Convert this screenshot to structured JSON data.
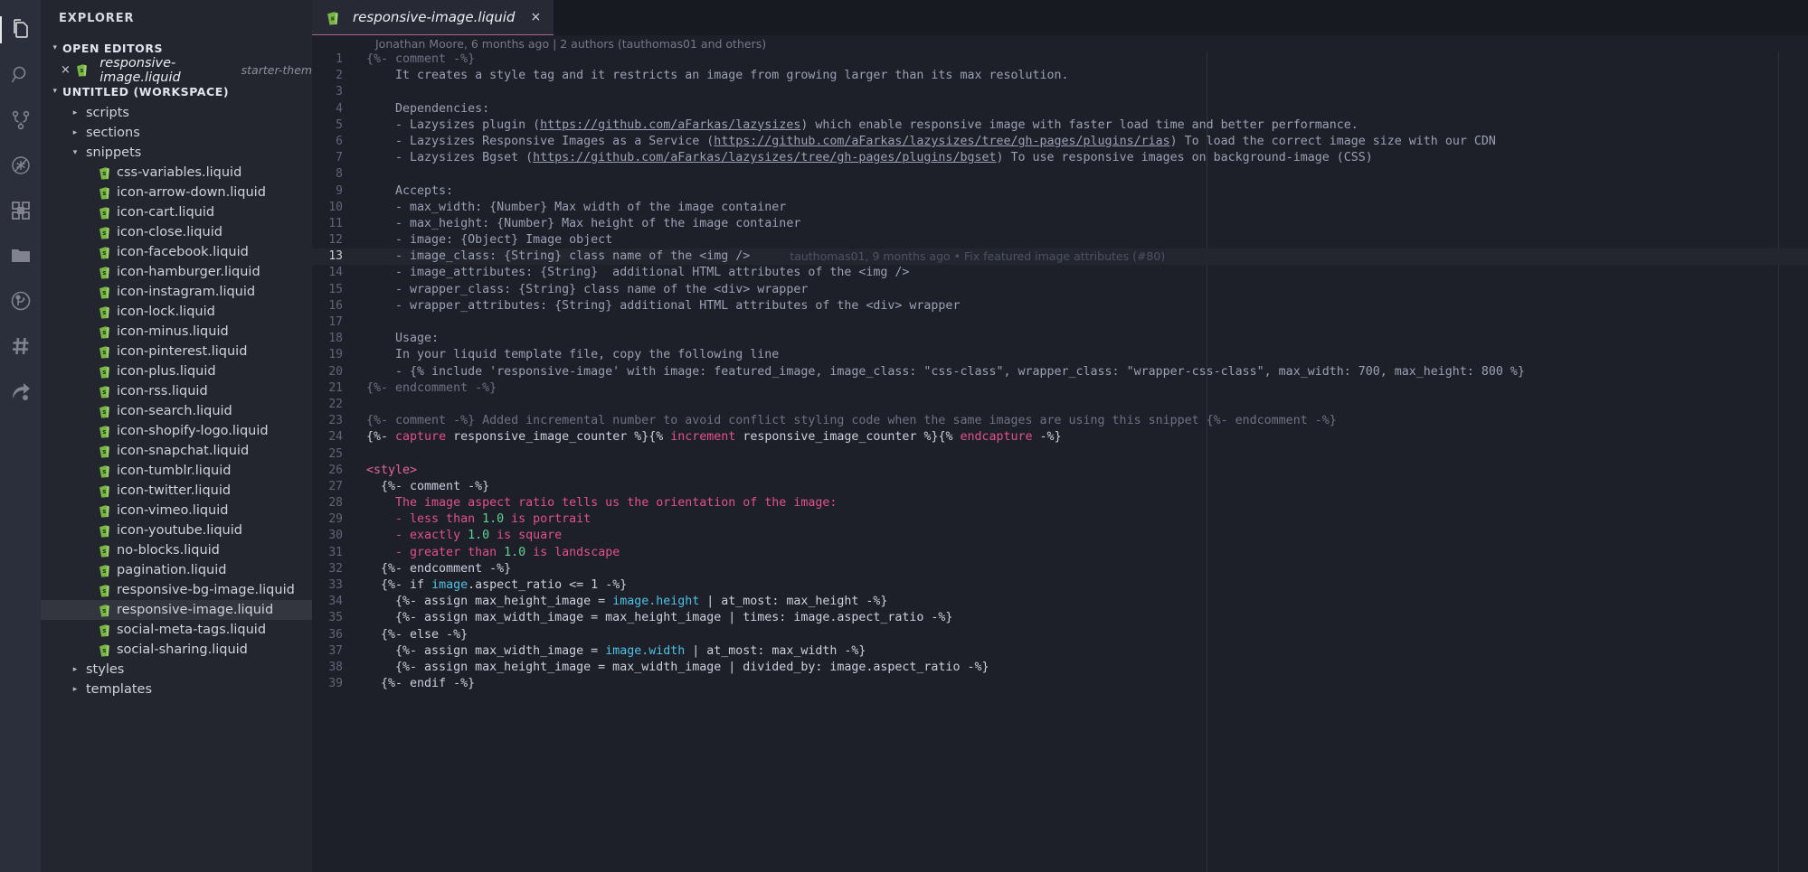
{
  "activity_bar": {
    "items": [
      {
        "name": "explorer",
        "icon": "files-icon",
        "active": true
      },
      {
        "name": "search",
        "icon": "search-icon",
        "active": false
      },
      {
        "name": "source-control",
        "icon": "source-control-icon",
        "active": false
      },
      {
        "name": "run-and-debug",
        "icon": "debug-disabled-icon",
        "active": false
      },
      {
        "name": "extensions",
        "icon": "extensions-icon",
        "active": false
      },
      {
        "name": "project-manager",
        "icon": "folder-icon",
        "active": false
      },
      {
        "name": "gitlens",
        "icon": "gitlens-icon",
        "active": false
      },
      {
        "name": "settings-sync",
        "icon": "hash-icon",
        "active": false
      },
      {
        "name": "share",
        "icon": "share-icon",
        "active": false
      }
    ]
  },
  "sidebar": {
    "title": "EXPLORER",
    "open_editors": {
      "label": "OPEN EDITORS",
      "expanded": true,
      "items": [
        {
          "close": "×",
          "name": "responsive-image.liquid",
          "description": "starter-them...",
          "icon": "liquid-icon"
        }
      ]
    },
    "workspace": {
      "label": "UNTITLED (WORKSPACE)",
      "expanded": true,
      "tree": [
        {
          "label": "scripts",
          "type": "folder",
          "expanded": false,
          "depth": 1
        },
        {
          "label": "sections",
          "type": "folder",
          "expanded": false,
          "depth": 1
        },
        {
          "label": "snippets",
          "type": "folder",
          "expanded": true,
          "depth": 1
        },
        {
          "label": "css-variables.liquid",
          "type": "file",
          "depth": 2
        },
        {
          "label": "icon-arrow-down.liquid",
          "type": "file",
          "depth": 2
        },
        {
          "label": "icon-cart.liquid",
          "type": "file",
          "depth": 2
        },
        {
          "label": "icon-close.liquid",
          "type": "file",
          "depth": 2
        },
        {
          "label": "icon-facebook.liquid",
          "type": "file",
          "depth": 2
        },
        {
          "label": "icon-hamburger.liquid",
          "type": "file",
          "depth": 2
        },
        {
          "label": "icon-instagram.liquid",
          "type": "file",
          "depth": 2
        },
        {
          "label": "icon-lock.liquid",
          "type": "file",
          "depth": 2
        },
        {
          "label": "icon-minus.liquid",
          "type": "file",
          "depth": 2
        },
        {
          "label": "icon-pinterest.liquid",
          "type": "file",
          "depth": 2
        },
        {
          "label": "icon-plus.liquid",
          "type": "file",
          "depth": 2
        },
        {
          "label": "icon-rss.liquid",
          "type": "file",
          "depth": 2
        },
        {
          "label": "icon-search.liquid",
          "type": "file",
          "depth": 2
        },
        {
          "label": "icon-shopify-logo.liquid",
          "type": "file",
          "depth": 2
        },
        {
          "label": "icon-snapchat.liquid",
          "type": "file",
          "depth": 2
        },
        {
          "label": "icon-tumblr.liquid",
          "type": "file",
          "depth": 2
        },
        {
          "label": "icon-twitter.liquid",
          "type": "file",
          "depth": 2
        },
        {
          "label": "icon-vimeo.liquid",
          "type": "file",
          "depth": 2
        },
        {
          "label": "icon-youtube.liquid",
          "type": "file",
          "depth": 2
        },
        {
          "label": "no-blocks.liquid",
          "type": "file",
          "depth": 2
        },
        {
          "label": "pagination.liquid",
          "type": "file",
          "depth": 2
        },
        {
          "label": "responsive-bg-image.liquid",
          "type": "file",
          "depth": 2
        },
        {
          "label": "responsive-image.liquid",
          "type": "file",
          "depth": 2,
          "selected": true
        },
        {
          "label": "social-meta-tags.liquid",
          "type": "file",
          "depth": 2
        },
        {
          "label": "social-sharing.liquid",
          "type": "file",
          "depth": 2
        },
        {
          "label": "styles",
          "type": "folder",
          "expanded": false,
          "depth": 1
        },
        {
          "label": "templates",
          "type": "folder",
          "expanded": false,
          "depth": 1
        }
      ]
    }
  },
  "editor": {
    "tab": {
      "title": "responsive-image.liquid",
      "icon": "liquid-icon",
      "close": "×",
      "active": true
    },
    "blame_header": "Jonathan Moore, 6 months ago | 2 authors (tauthomas01 and others)",
    "cursor_line": 13,
    "inline_blame": "tauthomas01, 9 months ago • Fix featured image attributes (#80)",
    "lines": [
      {
        "n": 1,
        "mod": false,
        "segs": [
          {
            "t": "{%- comment -%}",
            "c": "c-comment"
          }
        ]
      },
      {
        "n": 2,
        "mod": true,
        "segs": [
          {
            "t": "    It creates a style tag and it restricts an image from growing larger than its max resolution.",
            "c": "c-doc"
          }
        ]
      },
      {
        "n": 3,
        "mod": true,
        "segs": [
          {
            "t": "",
            "c": "c-doc"
          }
        ]
      },
      {
        "n": 4,
        "mod": true,
        "segs": [
          {
            "t": "    Dependencies:",
            "c": "c-doc"
          }
        ]
      },
      {
        "n": 5,
        "mod": true,
        "segs": [
          {
            "t": "    - Lazysizes plugin (",
            "c": "c-doc"
          },
          {
            "t": "https://github.com/aFarkas/lazysizes",
            "c": "c-link"
          },
          {
            "t": ") which enable responsive image with faster load time and better performance.",
            "c": "c-doc"
          }
        ]
      },
      {
        "n": 6,
        "mod": true,
        "segs": [
          {
            "t": "    - Lazysizes Responsive Images as a Service (",
            "c": "c-doc"
          },
          {
            "t": "https://github.com/aFarkas/lazysizes/tree/gh-pages/plugins/rias",
            "c": "c-link"
          },
          {
            "t": ") To load the correct image size with our CDN",
            "c": "c-doc"
          }
        ]
      },
      {
        "n": 7,
        "mod": true,
        "segs": [
          {
            "t": "    - Lazysizes Bgset (",
            "c": "c-doc"
          },
          {
            "t": "https://github.com/aFarkas/lazysizes/tree/gh-pages/plugins/bgset",
            "c": "c-link"
          },
          {
            "t": ") To use responsive images on background-image (CSS)",
            "c": "c-doc"
          }
        ]
      },
      {
        "n": 8,
        "mod": true,
        "segs": [
          {
            "t": "",
            "c": "c-doc"
          }
        ]
      },
      {
        "n": 9,
        "mod": true,
        "segs": [
          {
            "t": "    Accepts:",
            "c": "c-doc"
          }
        ]
      },
      {
        "n": 10,
        "mod": true,
        "segs": [
          {
            "t": "    - max_width: {Number} Max width of the image container",
            "c": "c-doc"
          }
        ]
      },
      {
        "n": 11,
        "mod": true,
        "segs": [
          {
            "t": "    - max_height: {Number} Max height of the image container",
            "c": "c-doc"
          }
        ]
      },
      {
        "n": 12,
        "mod": true,
        "segs": [
          {
            "t": "    - image: {Object} Image object",
            "c": "c-doc"
          }
        ]
      },
      {
        "n": 13,
        "mod": true,
        "cursor": true,
        "segs": [
          {
            "t": "    - image_class: {String} class name of the <img />",
            "c": "c-doc"
          }
        ]
      },
      {
        "n": 14,
        "mod": true,
        "segs": [
          {
            "t": "    - image_attributes: {String}  additional HTML attributes of the <img />",
            "c": "c-doc"
          }
        ]
      },
      {
        "n": 15,
        "mod": true,
        "segs": [
          {
            "t": "    - wrapper_class: {String} class name of the <div> wrapper",
            "c": "c-doc"
          }
        ]
      },
      {
        "n": 16,
        "mod": true,
        "segs": [
          {
            "t": "    - wrapper_attributes: {String} additional HTML attributes of the <div> wrapper",
            "c": "c-doc"
          }
        ]
      },
      {
        "n": 17,
        "mod": true,
        "segs": [
          {
            "t": "",
            "c": "c-doc"
          }
        ]
      },
      {
        "n": 18,
        "mod": true,
        "segs": [
          {
            "t": "    Usage:",
            "c": "c-doc"
          }
        ]
      },
      {
        "n": 19,
        "mod": true,
        "segs": [
          {
            "t": "    In your liquid template file, copy the following line",
            "c": "c-doc"
          }
        ]
      },
      {
        "n": 20,
        "mod": true,
        "segs": [
          {
            "t": "    - {% include 'responsive-image' with image: featured_image, image_class: \"css-class\", wrapper_class: \"wrapper-css-class\", max_width: 700, max_height: 800 %}",
            "c": "c-doc"
          }
        ]
      },
      {
        "n": 21,
        "mod": false,
        "segs": [
          {
            "t": "{%- endcomment -%}",
            "c": "c-comment"
          }
        ]
      },
      {
        "n": 22,
        "mod": false,
        "segs": [
          {
            "t": "",
            "c": "c-plain"
          }
        ]
      },
      {
        "n": 23,
        "mod": false,
        "segs": [
          {
            "t": "{%- comment -%} Added incremental number to avoid conflict styling code when the same images are using this snippet {%- endcomment -%}",
            "c": "c-comment"
          }
        ]
      },
      {
        "n": 24,
        "mod": false,
        "segs": [
          {
            "t": "{%- ",
            "c": "c-plain"
          },
          {
            "t": "capture",
            "c": "c-kw"
          },
          {
            "t": " responsive_image_counter %}{% ",
            "c": "c-plain"
          },
          {
            "t": "increment",
            "c": "c-kw"
          },
          {
            "t": " responsive_image_counter %}{% ",
            "c": "c-plain"
          },
          {
            "t": "endcapture",
            "c": "c-kw"
          },
          {
            "t": " -%}",
            "c": "c-plain"
          }
        ]
      },
      {
        "n": 25,
        "mod": false,
        "segs": [
          {
            "t": "",
            "c": "c-plain"
          }
        ]
      },
      {
        "n": 26,
        "mod": false,
        "segs": [
          {
            "t": "<style>",
            "c": "c-tag"
          }
        ]
      },
      {
        "n": 27,
        "mod": false,
        "segs": [
          {
            "t": "  {%- comment -%}",
            "c": "c-plain"
          }
        ]
      },
      {
        "n": 28,
        "mod": false,
        "segs": [
          {
            "t": "    The image aspect ratio tells us the orientation of the image:",
            "c": "c-pink"
          }
        ]
      },
      {
        "n": 29,
        "mod": false,
        "segs": [
          {
            "t": "    - less than ",
            "c": "c-pink"
          },
          {
            "t": "1.0",
            "c": "c-num"
          },
          {
            "t": " is portrait",
            "c": "c-pink"
          }
        ]
      },
      {
        "n": 30,
        "mod": false,
        "segs": [
          {
            "t": "    - exactly ",
            "c": "c-pink"
          },
          {
            "t": "1.0",
            "c": "c-num"
          },
          {
            "t": " is square",
            "c": "c-pink"
          }
        ]
      },
      {
        "n": 31,
        "mod": false,
        "segs": [
          {
            "t": "    - greater than ",
            "c": "c-pink"
          },
          {
            "t": "1.0",
            "c": "c-num"
          },
          {
            "t": " is landscape",
            "c": "c-pink"
          }
        ]
      },
      {
        "n": 32,
        "mod": false,
        "segs": [
          {
            "t": "  {%- endcomment -%}",
            "c": "c-plain"
          }
        ]
      },
      {
        "n": 33,
        "mod": false,
        "segs": [
          {
            "t": "  {%- if ",
            "c": "c-plain"
          },
          {
            "t": "image",
            "c": "c-var"
          },
          {
            "t": ".aspect_ratio <= 1 -%}",
            "c": "c-plain"
          }
        ]
      },
      {
        "n": 34,
        "mod": false,
        "segs": [
          {
            "t": "    {%- assign max_height_image = ",
            "c": "c-plain"
          },
          {
            "t": "image",
            "c": "c-var"
          },
          {
            "t": ".height",
            "c": "c-var"
          },
          {
            "t": " | at_most: max_height -%}",
            "c": "c-plain"
          }
        ]
      },
      {
        "n": 35,
        "mod": false,
        "segs": [
          {
            "t": "    {%- assign max_width_image = max_height_image | times: image.aspect_ratio -%}",
            "c": "c-plain"
          }
        ]
      },
      {
        "n": 36,
        "mod": false,
        "segs": [
          {
            "t": "  {%- else -%}",
            "c": "c-plain"
          }
        ]
      },
      {
        "n": 37,
        "mod": false,
        "segs": [
          {
            "t": "    {%- assign max_width_image = ",
            "c": "c-plain"
          },
          {
            "t": "image",
            "c": "c-var"
          },
          {
            "t": ".width",
            "c": "c-var"
          },
          {
            "t": " | at_most: max_width -%}",
            "c": "c-plain"
          }
        ]
      },
      {
        "n": 38,
        "mod": false,
        "segs": [
          {
            "t": "    {%- assign max_height_image = max_width_image | divided_by: image.aspect_ratio -%}",
            "c": "c-plain"
          }
        ]
      },
      {
        "n": 39,
        "mod": false,
        "segs": [
          {
            "t": "  {%- endif -%}",
            "c": "c-plain"
          }
        ]
      }
    ]
  },
  "colors": {
    "activity_bar_bg": "#2b2e3b",
    "sidebar_bg": "#24262f",
    "editor_bg": "#1e2029",
    "tab_active_bg": "#272a35",
    "tab_accent": "#b3608a",
    "keyword": "#e0518b",
    "variable": "#4fc1e4",
    "number": "#62d196",
    "comment": "#6d7184"
  }
}
